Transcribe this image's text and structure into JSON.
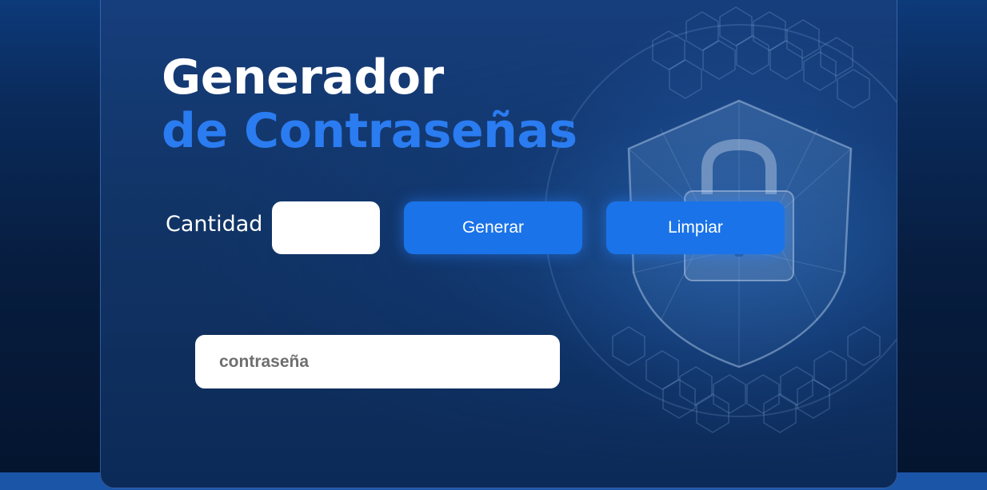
{
  "title": {
    "line1": "Generador",
    "line2": "de Contraseñas"
  },
  "quantity": {
    "label": "Cantidad",
    "value": "",
    "placeholder": ""
  },
  "buttons": {
    "generate": "Generar",
    "clear": "Limpiar"
  },
  "password": {
    "value": "",
    "placeholder": "contraseña"
  },
  "colors": {
    "accent": "#1a73e8",
    "title_highlight": "#2a7cf0",
    "background_dark": "#071d3f"
  },
  "decoration": {
    "illustration": "shield-lock-globe-icon"
  }
}
